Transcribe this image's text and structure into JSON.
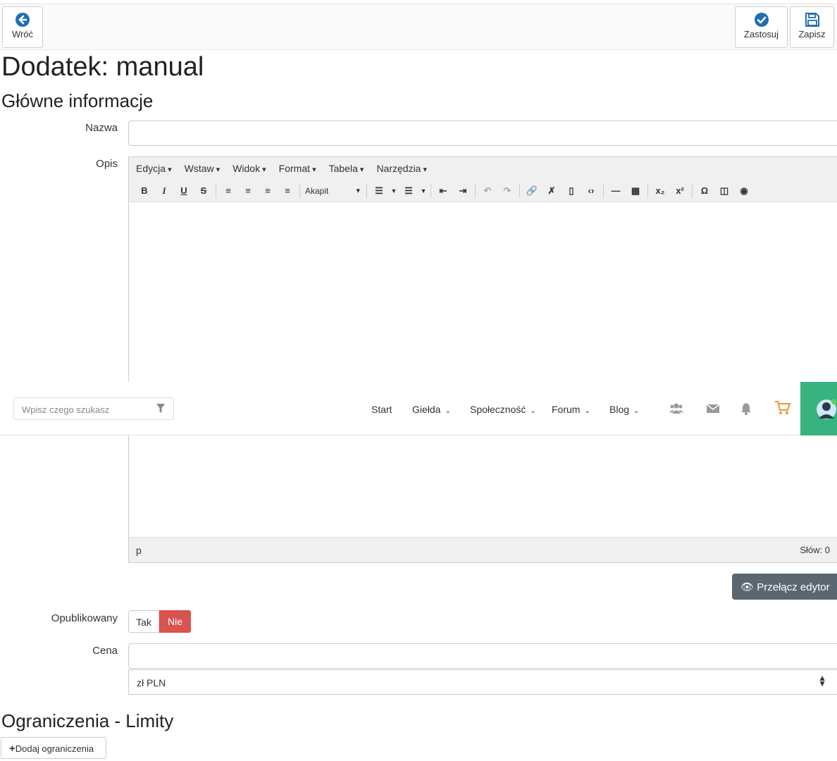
{
  "toolbar": {
    "back_label": "Wróć",
    "apply_label": "Zastosuj",
    "save_label": "Zapisz"
  },
  "page_title": "Dodatek: manual",
  "section_main": "Główne informacje",
  "fields": {
    "name_label": "Nazwa",
    "name_value": "",
    "desc_label": "Opis",
    "published_label": "Opublikowany",
    "price_label": "Cena",
    "price_value": ""
  },
  "editor": {
    "menu": [
      "Edycja",
      "Wstaw",
      "Widok",
      "Format",
      "Tabela",
      "Narzędzia"
    ],
    "block_format": "Akapit",
    "status_path": "p",
    "word_count": "Słów: 0"
  },
  "sitenav": {
    "search_placeholder": "Wpisz czego szukasz",
    "links": [
      "Start",
      "Giełda",
      "Społeczność",
      "Forum",
      "Blog"
    ]
  },
  "toggle_editor_label": "Przełącz edytor",
  "published": {
    "yes": "Tak",
    "no": "Nie",
    "selected": "Nie"
  },
  "currency": {
    "selected": "zł PLN"
  },
  "section_limits": "Ograniczenia - Limity",
  "add_limit_label": "Dodaj ograniczenia",
  "colors": {
    "accent": "#2a7fd4",
    "danger": "#d9534f",
    "green": "#36b37e"
  }
}
